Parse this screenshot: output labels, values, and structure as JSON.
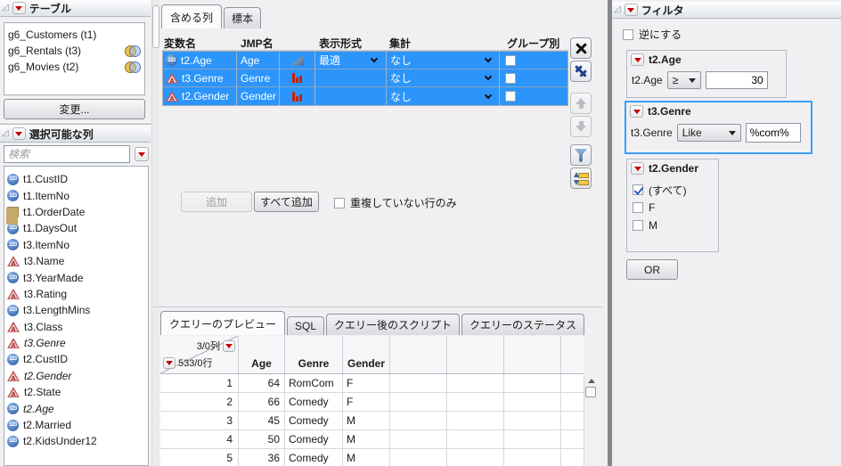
{
  "left": {
    "tables": {
      "title": "テーブル",
      "items": [
        {
          "label": "g6_Customers (t1)",
          "join": false
        },
        {
          "label": "g6_Rentals (t3)",
          "join": true
        },
        {
          "label": "g6_Movies (t2)",
          "join": true
        }
      ],
      "change_button": "変更..."
    },
    "columns": {
      "title": "選択可能な列",
      "search_placeholder": "検索",
      "items": [
        {
          "label": "t1.CustID",
          "type": "numeric",
          "used": false
        },
        {
          "label": "t1.ItemNo",
          "type": "numeric",
          "used": false
        },
        {
          "label": "t1.OrderDate",
          "type": "date",
          "used": false
        },
        {
          "label": "t1.DaysOut",
          "type": "numeric",
          "used": false
        },
        {
          "label": "t3.ItemNo",
          "type": "numeric",
          "used": false
        },
        {
          "label": "t3.Name",
          "type": "character",
          "used": false
        },
        {
          "label": "t3.YearMade",
          "type": "numeric",
          "used": false
        },
        {
          "label": "t3.Rating",
          "type": "character",
          "used": false
        },
        {
          "label": "t3.LengthMins",
          "type": "numeric",
          "used": false
        },
        {
          "label": "t3.Class",
          "type": "character",
          "used": false
        },
        {
          "label": "t3.Genre",
          "type": "character",
          "used": true
        },
        {
          "label": "t2.CustID",
          "type": "numeric",
          "used": false
        },
        {
          "label": "t2.Gender",
          "type": "character",
          "used": true
        },
        {
          "label": "t2.State",
          "type": "character",
          "used": false
        },
        {
          "label": "t2.Age",
          "type": "numeric",
          "used": true
        },
        {
          "label": "t2.Married",
          "type": "numeric",
          "used": false
        },
        {
          "label": "t2.KidsUnder12",
          "type": "numeric",
          "used": false
        }
      ]
    }
  },
  "center": {
    "top_tabs": [
      "含める列",
      "標本"
    ],
    "grid": {
      "headers": [
        "変数名",
        "JMP名",
        "",
        "表示形式",
        "集計",
        "グループ別"
      ],
      "rows": [
        {
          "name": "t2.Age",
          "jmp": "Age",
          "type": "numeric",
          "model": "continuous",
          "format": "最適",
          "agg": "なし",
          "group_by": false
        },
        {
          "name": "t3.Genre",
          "jmp": "Genre",
          "type": "character",
          "model": "nominal",
          "format": "",
          "agg": "なし",
          "group_by": false
        },
        {
          "name": "t2.Gender",
          "jmp": "Gender",
          "type": "character",
          "model": "nominal",
          "agg": "なし",
          "format": "",
          "group_by": false
        }
      ]
    },
    "add_button": "追加",
    "add_all_button": "すべて追加",
    "distinct_label": "重複していない行のみ",
    "bottom_tabs": [
      "クエリーのプレビュー",
      "SQL",
      "クエリー後のスクリプト",
      "クエリーのステータス"
    ],
    "preview": {
      "cols_badge": "3/0列",
      "rows_badge": "533/0行",
      "headers": [
        "Age",
        "Genre",
        "Gender"
      ],
      "rows": [
        {
          "n": "1",
          "age": "64",
          "genre": "RomCom",
          "gender": "F"
        },
        {
          "n": "2",
          "age": "66",
          "genre": "Comedy",
          "gender": "F"
        },
        {
          "n": "3",
          "age": "45",
          "genre": "Comedy",
          "gender": "M"
        },
        {
          "n": "4",
          "age": "50",
          "genre": "Comedy",
          "gender": "M"
        },
        {
          "n": "5",
          "age": "36",
          "genre": "Comedy",
          "gender": "M"
        }
      ]
    }
  },
  "filter": {
    "title": "フィルタ",
    "invert_label": "逆にする",
    "age": {
      "title": "t2.Age",
      "field": "t2.Age",
      "operator": "≥",
      "value": "30"
    },
    "genre": {
      "title": "t3.Genre",
      "field": "t3.Genre",
      "operator": "Like",
      "value": "%com%"
    },
    "gender": {
      "title": "t2.Gender",
      "options": [
        {
          "label": "(すべて)",
          "checked": true
        },
        {
          "label": "F",
          "checked": false
        },
        {
          "label": "M",
          "checked": false
        }
      ]
    },
    "or_button": "OR"
  },
  "colors": {
    "selection_blue": "#2b95fc",
    "highlight_border": "#3b9ff7",
    "menu_triangle_red": "#c40000"
  }
}
